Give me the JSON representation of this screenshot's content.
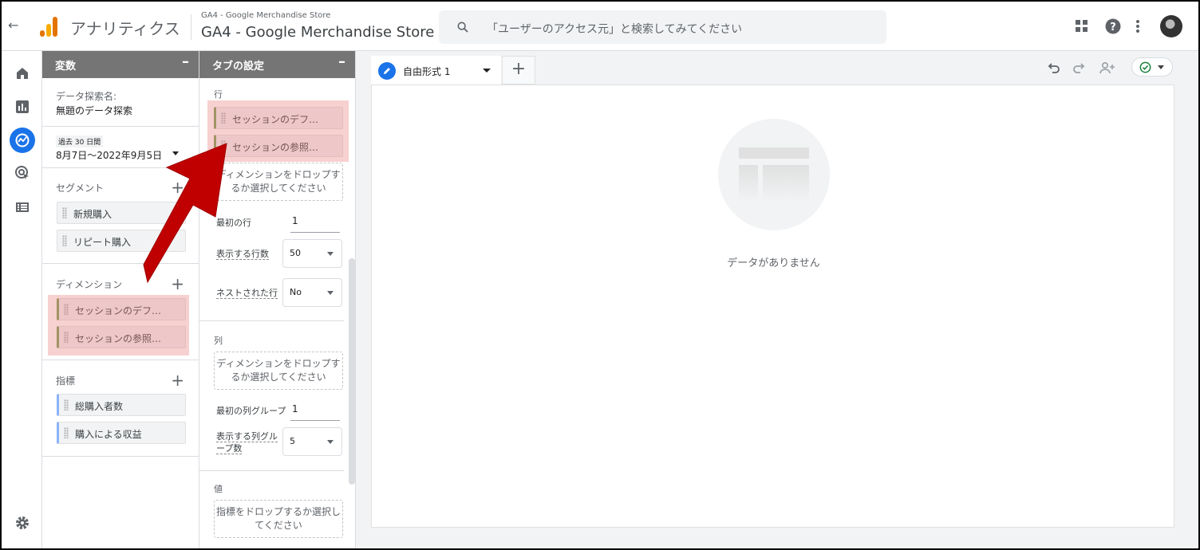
{
  "header": {
    "back_icon": "arrow-back-icon",
    "app_name": "アナリティクス",
    "property_small": "GA4 - Google Merchandise Store",
    "property_big": "GA4 - Google Merchandise Store",
    "search_placeholder": "「ユーザーのアクセス元」と検索してみてください",
    "icons": [
      "apps-grid-icon",
      "help-icon",
      "more-vert-icon",
      "avatar"
    ]
  },
  "rail": {
    "items": [
      "home-icon",
      "reports-icon",
      "explore-icon",
      "advertising-icon",
      "configure-icon"
    ],
    "active": "explore-icon",
    "bottom": "settings-icon"
  },
  "variables": {
    "title": "変数",
    "exploration_label": "データ探索名:",
    "exploration_name": "無題のデータ探索",
    "date_badge": "過去 30 日間",
    "date_range": "8月7日～2022年9月5日",
    "segments_label": "セグメント",
    "segments": [
      "新規購入",
      "リピート購入"
    ],
    "dimensions_label": "ディメンション",
    "dimensions": [
      "セッションのデフ…",
      "セッションの参照…"
    ],
    "metrics_label": "指標",
    "metrics": [
      "総購入者数",
      "購入による収益"
    ]
  },
  "tab_settings": {
    "title": "タブの設定",
    "rows_label": "行",
    "rows": [
      "セッションのデフ…",
      "セッションの参照…"
    ],
    "drop_dimension": "ディメンションをドロップするか選択してください",
    "first_row_label": "最初の行",
    "first_row_value": "1",
    "show_rows_label": "表示する行数",
    "show_rows_value": "50",
    "nested_label": "ネストされた行",
    "nested_value": "No",
    "columns_label": "列",
    "drop_dimension_col": "ディメンションをドロップするか選択してください",
    "first_col_group_label": "最初の列グループ",
    "first_col_group_value": "1",
    "show_col_groups_label": "表示する列グループ数",
    "show_col_groups_value": "5",
    "values_label": "値",
    "drop_metric": "指標をドロップするか選択してください"
  },
  "canvas": {
    "tab_label": "自由形式 1",
    "add_tab": "+",
    "empty_text": "データがありません",
    "toolbar_icons": [
      "undo-icon",
      "redo-icon",
      "share-icon",
      "check-circle-icon"
    ]
  },
  "annotation": {
    "arrow_color": "#c00000",
    "highlight_color": "#e77878"
  }
}
